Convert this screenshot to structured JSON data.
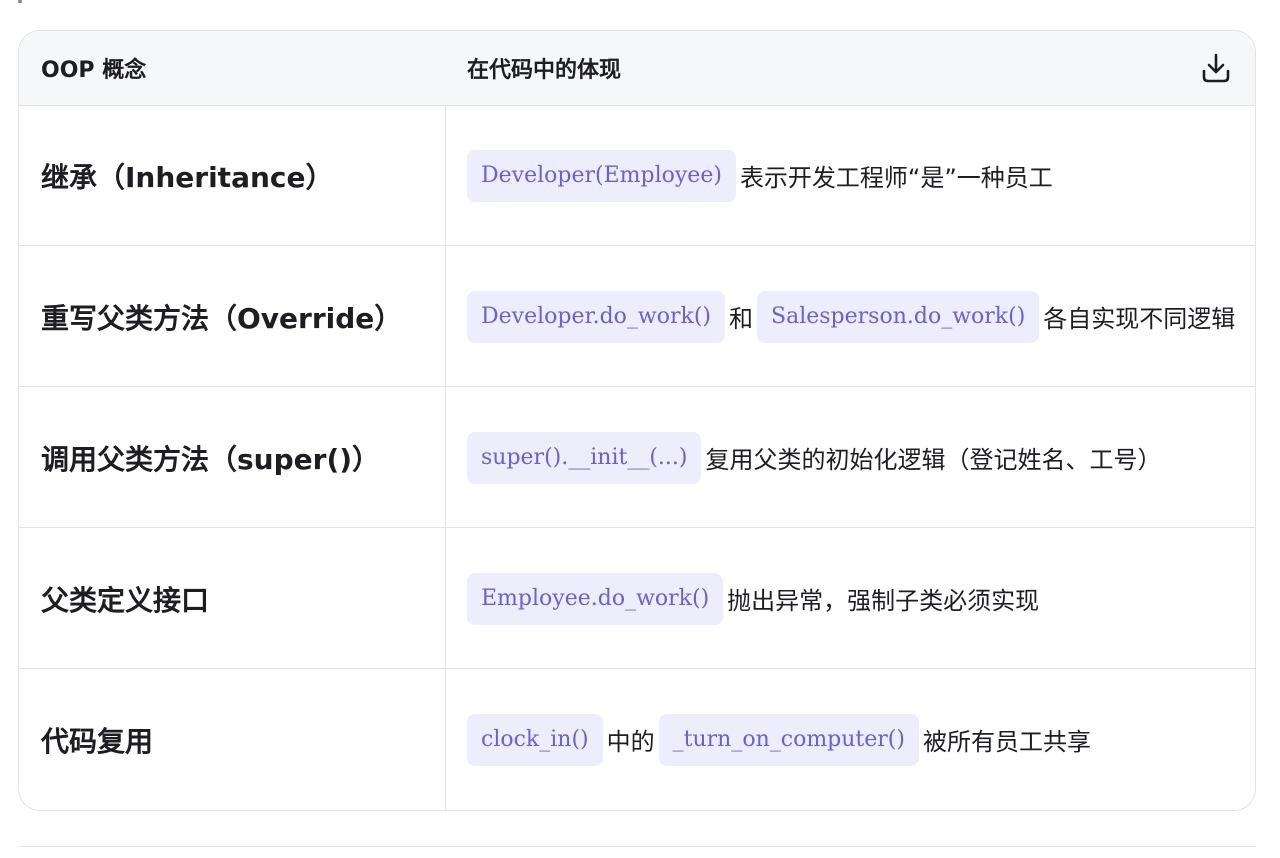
{
  "table": {
    "headers": [
      "OOP 概念",
      "在代码中的体现"
    ],
    "rows": [
      {
        "concept": "继承（Inheritance）",
        "desc": [
          {
            "code": "Developer(Employee)"
          },
          {
            "text": "表示开发工程师“是”一种员工"
          }
        ]
      },
      {
        "concept": "重写父类方法（Override）",
        "desc": [
          {
            "code": "Developer.do_work()"
          },
          {
            "text": "和"
          },
          {
            "code": "Salesperson.do_work()"
          },
          {
            "text": "各自实现不同逻辑"
          }
        ]
      },
      {
        "concept": "调用父类方法（super()）",
        "desc": [
          {
            "code": "super().__init__(...)"
          },
          {
            "text": "复用父类的初始化逻辑（登记姓名、工号）"
          }
        ]
      },
      {
        "concept": "父类定义接口",
        "desc": [
          {
            "code": "Employee.do_work()"
          },
          {
            "text": "抛出异常，强制子类必须实现"
          }
        ]
      },
      {
        "concept": "代码复用",
        "desc": [
          {
            "code": "clock_in()"
          },
          {
            "text": "中的"
          },
          {
            "code": "_turn_on_computer()"
          },
          {
            "text": "被所有员工共享"
          }
        ]
      }
    ]
  },
  "icons": {
    "download": "download-icon"
  },
  "colors": {
    "chip_background": "#ededfc",
    "chip_text": "#6b5fd6",
    "header_background": "#f6f7f9",
    "border": "#e2e2e7"
  }
}
